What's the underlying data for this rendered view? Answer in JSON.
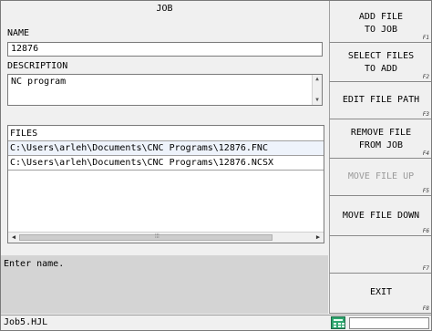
{
  "window": {
    "title": "JOB"
  },
  "name": {
    "label": "NAME",
    "value": "12876"
  },
  "description": {
    "label": "DESCRIPTION",
    "value": "NC program"
  },
  "files": {
    "header": "FILES",
    "items": [
      "C:\\Users\\arleh\\Documents\\CNC Programs\\12876.FNC",
      "C:\\Users\\arleh\\Documents\\CNC Programs\\12876.NCSX"
    ]
  },
  "status": {
    "message": "Enter name."
  },
  "function_keys": [
    {
      "line1": "ADD FILE",
      "line2": "TO JOB",
      "key": "F1",
      "enabled": true
    },
    {
      "line1": "SELECT FILES",
      "line2": "TO ADD",
      "key": "F2",
      "enabled": true
    },
    {
      "line1": "EDIT FILE PATH",
      "line2": "",
      "key": "F3",
      "enabled": true
    },
    {
      "line1": "REMOVE FILE",
      "line2": "FROM JOB",
      "key": "F4",
      "enabled": true
    },
    {
      "line1": "MOVE FILE UP",
      "line2": "",
      "key": "F5",
      "enabled": false
    },
    {
      "line1": "MOVE FILE DOWN",
      "line2": "",
      "key": "F6",
      "enabled": true
    },
    {
      "line1": "",
      "line2": "",
      "key": "F7",
      "enabled": true
    },
    {
      "line1": "EXIT",
      "line2": "",
      "key": "F8",
      "enabled": true
    }
  ],
  "bottom_bar": {
    "filename": "Job5.HJL",
    "calculator_icon": "calculator-icon"
  }
}
